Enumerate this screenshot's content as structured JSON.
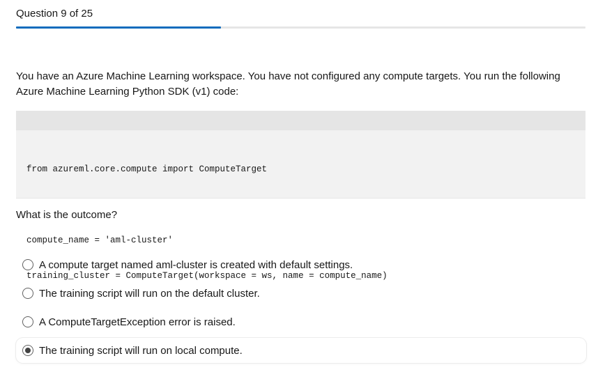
{
  "header": {
    "counter": "Question 9 of 25",
    "progress_fraction": 0.36
  },
  "question": {
    "text": "You have an Azure Machine Learning workspace. You have not configured any compute targets. You run the following Azure Machine Learning Python SDK (v1) code:",
    "code_lines": [
      "from azureml.core.compute import ComputeTarget",
      "",
      "compute_name = 'aml-cluster'",
      "training_cluster = ComputeTarget(workspace = ws, name = compute_name)"
    ],
    "prompt": "What is the outcome?"
  },
  "options": [
    {
      "label": "A compute target named aml-cluster is created with default settings.",
      "selected": false
    },
    {
      "label": "The training script will run on the default cluster.",
      "selected": false
    },
    {
      "label": "A ComputeTargetException error is raised.",
      "selected": false
    },
    {
      "label": "The training script will run on local compute.",
      "selected": true
    }
  ],
  "colors": {
    "accent": "#0f6cbd",
    "track": "#e6e6e6",
    "code_bg": "#f2f2f2"
  }
}
